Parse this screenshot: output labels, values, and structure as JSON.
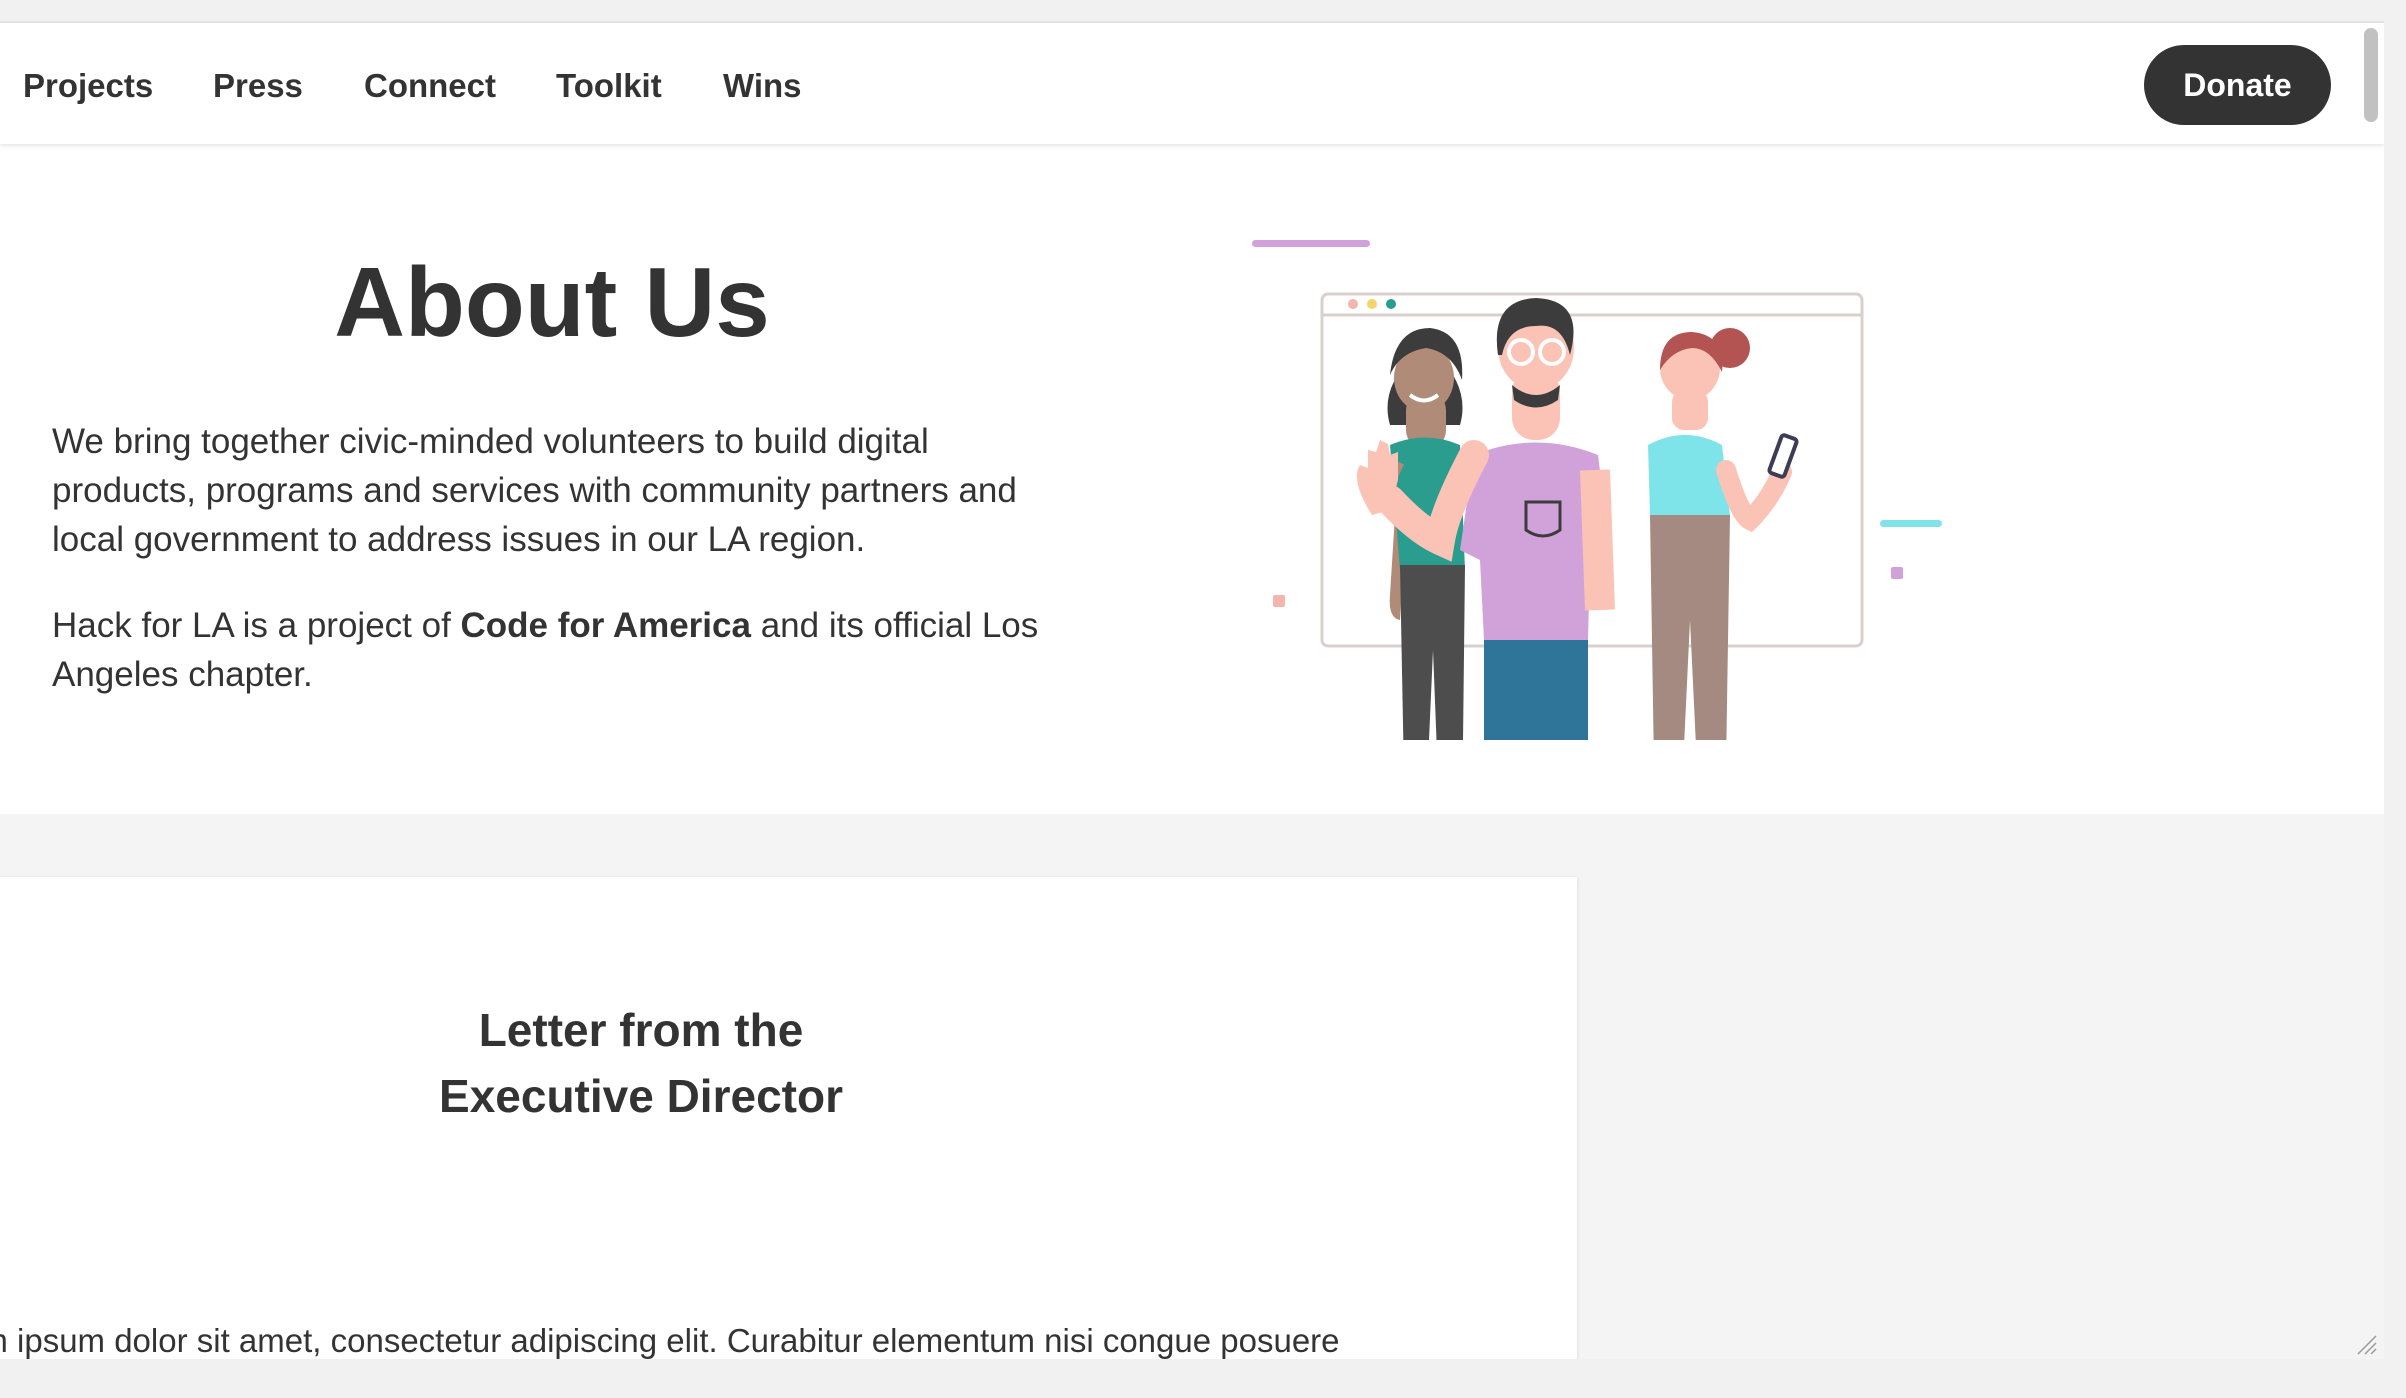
{
  "nav": {
    "links": [
      "Projects",
      "Press",
      "Connect",
      "Toolkit",
      "Wins"
    ],
    "donate_label": "Donate"
  },
  "about": {
    "title": "About Us",
    "paragraph1": "We bring together civic-minded volunteers to build digital products, programs and services with community partners and local government to address issues in our LA region.",
    "paragraph2_prefix": "Hack for LA is a project of ",
    "paragraph2_bold": "Code for America",
    "paragraph2_suffix": " and its official Los Angeles chapter."
  },
  "letter": {
    "title_line1": "Letter from the",
    "title_line2": "Executive Director",
    "body": "em ipsum dolor sit amet, consectetur adipiscing elit. Curabitur elementum nisi congue posuere"
  },
  "colors": {
    "primary_text": "#333333",
    "donate_bg": "#333333",
    "section_bg": "#f5f4f4",
    "accent_purple": "#d0a2d9",
    "accent_cyan": "#7fe3ea",
    "accent_pink": "#f5b5ad"
  },
  "icons": {
    "illustration": "three-volunteers-illustration",
    "grip": "resize-grip-icon"
  }
}
